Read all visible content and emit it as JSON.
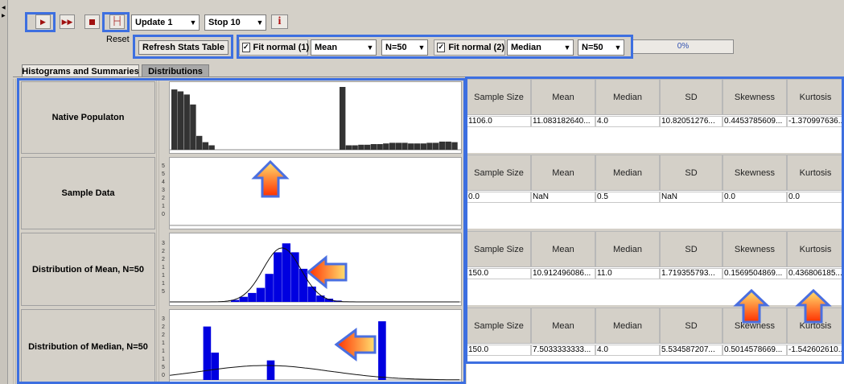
{
  "toolbar": {
    "update_select": "Update 1",
    "stop_select": "Stop 10",
    "info_label": "i",
    "reset_label": "Reset",
    "refresh_label": "Refresh Stats Table",
    "fit1_label": "Fit normal (1)",
    "fit1_stat": "Mean",
    "fit1_n": "N=50",
    "fit2_label": "Fit normal (2)",
    "fit2_stat": "Median",
    "fit2_n": "N=50",
    "progress_text": "0%",
    "progress_value": 0,
    "icons": [
      "play-icon",
      "fast-forward-icon",
      "stop-icon",
      "step-back-icon",
      "info-icon"
    ]
  },
  "tabs": [
    {
      "label": "Histograms and Summaries",
      "active": true
    },
    {
      "label": "Distributions",
      "active": false
    }
  ],
  "rows": [
    {
      "label": "Native Populaton",
      "headers": [
        "Sample Size",
        "Mean",
        "Median",
        "SD",
        "Skewness",
        "Kurtosis"
      ],
      "values": [
        "1106.0",
        "11.083182640...",
        "4.0",
        "10.82051276...",
        "0.4453785609...",
        "-1.370997636..."
      ],
      "bars": [
        0.96,
        0.93,
        0.88,
        0.72,
        0.22,
        0.12,
        0.07,
        0.0,
        0.0,
        0.0,
        0.0,
        0.0,
        0.0,
        0.0,
        0.0,
        0.0,
        0.0,
        0.0,
        0.0,
        0.0,
        0.0,
        0.0,
        0.0,
        0.0,
        0.0,
        0.0,
        0.0,
        1.0,
        0.07,
        0.07,
        0.08,
        0.08,
        0.09,
        0.09,
        0.1,
        0.11,
        0.11,
        0.11,
        0.1,
        0.1,
        0.1,
        0.11,
        0.11,
        0.13,
        0.13,
        0.12
      ],
      "bar_color": "#333333",
      "yticks": []
    },
    {
      "label": "Sample Data",
      "headers": [
        "Sample Size",
        "Mean",
        "Median",
        "SD",
        "Skewness",
        "Kurtosis"
      ],
      "values": [
        "0.0",
        "NaN",
        "0.5",
        "NaN",
        "0.0",
        "0.0"
      ],
      "bars": [],
      "bar_color": "#333333",
      "yticks": [
        "5",
        "5",
        "4",
        "3",
        "2",
        "1",
        "0"
      ]
    },
    {
      "label": "Distribution of Mean, N=50",
      "headers": [
        "Sample Size",
        "Mean",
        "Median",
        "SD",
        "Skewness",
        "Kurtosis"
      ],
      "values": [
        "150.0",
        "10.912496086...",
        "11.0",
        "1.719355793...",
        "0.1569504869...",
        "0.436806185..."
      ],
      "bars": [
        0.03,
        0.08,
        0.14,
        0.22,
        0.44,
        0.78,
        0.92,
        0.78,
        0.52,
        0.24,
        0.1,
        0.05,
        0.02
      ],
      "bar_color": "#0000e0",
      "yticks": [
        "3",
        "2",
        "2",
        "1",
        "1",
        "1",
        "5"
      ]
    },
    {
      "label": "Distribution of Median, N=50",
      "headers": [
        "Sample Size",
        "Mean",
        "Median",
        "SD",
        "Skewness",
        "Kurtosis"
      ],
      "values": [
        "150.0",
        "7.5033333333...",
        "4.0",
        "5.534587207...",
        "0.5014578669...",
        "-1.542602610..."
      ],
      "bars": [
        0.0,
        0.0,
        0.0,
        0.0,
        0.82,
        0.42,
        0.0,
        0.0,
        0.0,
        0.0,
        0.0,
        0.0,
        0.3,
        0.0,
        0.0,
        0.0,
        0.0,
        0.0,
        0.0,
        0.0,
        0.0,
        0.0,
        0.0,
        0.0,
        0.0,
        0.0,
        0.9,
        0.0,
        0.0,
        0.0,
        0.0,
        0.0,
        0.0,
        0.0,
        0.0,
        0.0
      ],
      "bar_color": "#0000e0",
      "yticks": [
        "3",
        "2",
        "2",
        "1",
        "1",
        "1",
        "5",
        "0"
      ]
    }
  ],
  "colors": {
    "highlight": "#3d6fe0",
    "arrow_fill_start": "#ff3000",
    "arrow_fill_end": "#ffe070",
    "bar_dark": "#333333",
    "bar_blue": "#0000e0"
  }
}
